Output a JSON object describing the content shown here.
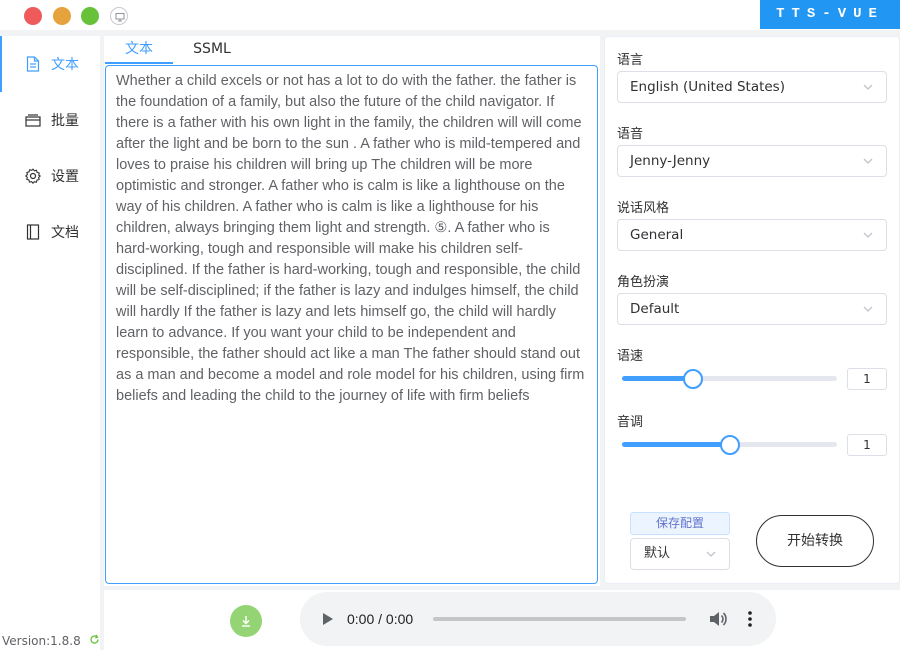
{
  "window": {
    "brand": "TTS-VUE"
  },
  "sidebar": {
    "items": [
      {
        "label": "文本",
        "icon": "document-icon",
        "active": true
      },
      {
        "label": "批量",
        "icon": "layers-icon",
        "active": false
      },
      {
        "label": "设置",
        "icon": "gear-icon",
        "active": false
      },
      {
        "label": "文档",
        "icon": "book-icon",
        "active": false
      }
    ],
    "version": "Version:1.8.8"
  },
  "editor": {
    "tabs": [
      {
        "label": "文本",
        "active": true
      },
      {
        "label": "SSML",
        "active": false
      }
    ],
    "text": "Whether a child excels or not has a lot to do with the father. the father is the foundation of a family, but also the future of the child navigator. If there is a father with his own light in the family, the children will will come after the light and be born to the sun . A father who is mild-tempered and loves to praise his children will bring up The children will be more optimistic and stronger. A father who is calm is like a lighthouse on the way of his children. A father who is calm is like a lighthouse for his children, always bringing them light and strength. ⑤. A father who is hard-working, tough and responsible will make his children self-disciplined. If the father is hard-working, tough and responsible, the child will be self-disciplined; if the father is lazy and indulges himself, the child will hardly If the father is lazy and lets himself go, the child will hardly learn to advance. If you want your child to be independent and responsible, the father should act like a man The father should stand out as a man and become a model and role model for his children, using firm beliefs and leading the child to the journey of life with firm beliefs"
  },
  "settings": {
    "language_label": "语言",
    "language_value": "English (United States)",
    "voice_label": "语音",
    "voice_value": "Jenny-Jenny",
    "style_label": "说话风格",
    "style_value": "General",
    "role_label": "角色扮演",
    "role_value": "Default",
    "rate_label": "语速",
    "rate_value": "1",
    "rate_fraction": 0.33,
    "pitch_label": "音调",
    "pitch_value": "1",
    "pitch_fraction": 0.5,
    "save_label": "保存配置",
    "preset_value": "默认",
    "start_label": "开始转换"
  },
  "player": {
    "time": "0:00 / 0:00"
  },
  "colors": {
    "accent": "#409eff",
    "brand_bg": "#2196f3",
    "download": "#95d475"
  }
}
